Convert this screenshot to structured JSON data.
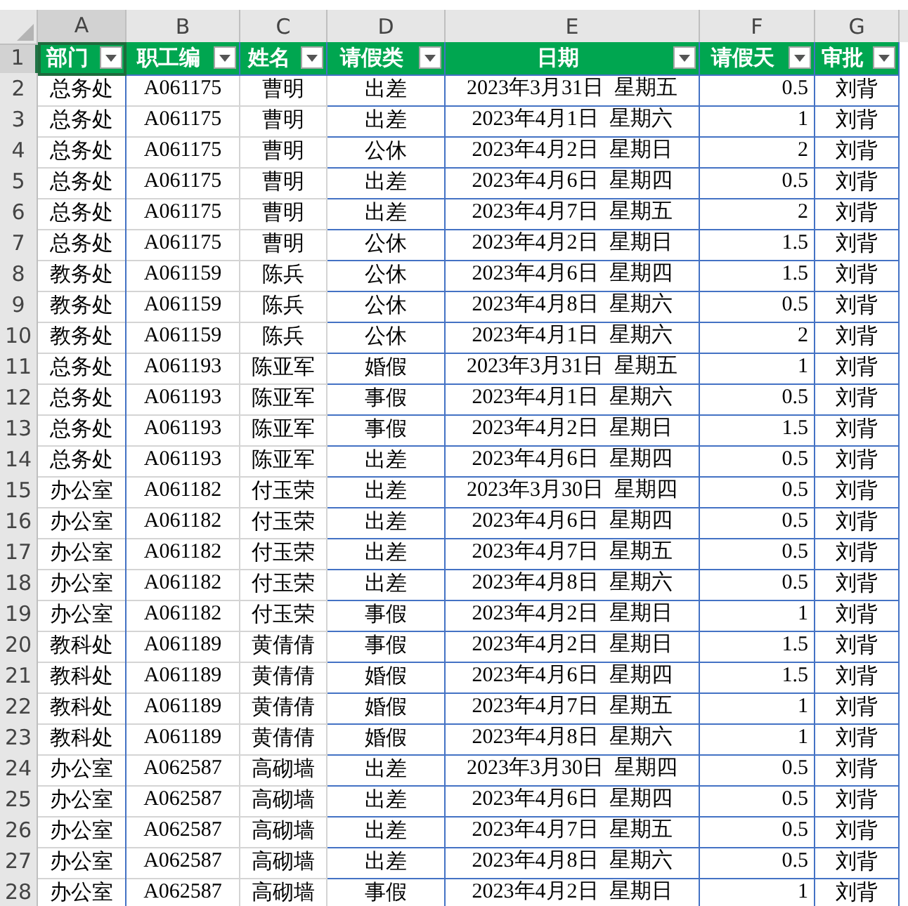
{
  "columns": [
    {
      "letter": "A",
      "selected": true
    },
    {
      "letter": "B",
      "selected": false
    },
    {
      "letter": "C",
      "selected": false
    },
    {
      "letter": "D",
      "selected": false
    },
    {
      "letter": "E",
      "selected": false
    },
    {
      "letter": "F",
      "selected": false
    },
    {
      "letter": "G",
      "selected": false
    }
  ],
  "header_row": {
    "number": "1",
    "selected": true,
    "cells": [
      {
        "text": "部门",
        "selected": true
      },
      {
        "text": "职工编",
        "selected": false
      },
      {
        "text": "姓名",
        "selected": false
      },
      {
        "text": "请假类",
        "selected": false
      },
      {
        "text": "日期",
        "selected": false
      },
      {
        "text": "请假天",
        "selected": false
      },
      {
        "text": "审批",
        "selected": false
      }
    ]
  },
  "rows": [
    {
      "number": "2",
      "selected": false,
      "cells": [
        "总务处",
        "A061175",
        "曹明",
        "出差",
        "2023年3月31日  星期五",
        "0.5",
        "刘背"
      ]
    },
    {
      "number": "3",
      "selected": false,
      "cells": [
        "总务处",
        "A061175",
        "曹明",
        "出差",
        "2023年4月1日  星期六",
        "1",
        "刘背"
      ]
    },
    {
      "number": "4",
      "selected": false,
      "cells": [
        "总务处",
        "A061175",
        "曹明",
        "公休",
        "2023年4月2日  星期日",
        "2",
        "刘背"
      ]
    },
    {
      "number": "5",
      "selected": false,
      "cells": [
        "总务处",
        "A061175",
        "曹明",
        "出差",
        "2023年4月6日  星期四",
        "0.5",
        "刘背"
      ]
    },
    {
      "number": "6",
      "selected": false,
      "cells": [
        "总务处",
        "A061175",
        "曹明",
        "出差",
        "2023年4月7日  星期五",
        "2",
        "刘背"
      ]
    },
    {
      "number": "7",
      "selected": false,
      "cells": [
        "总务处",
        "A061175",
        "曹明",
        "公休",
        "2023年4月2日  星期日",
        "1.5",
        "刘背"
      ]
    },
    {
      "number": "8",
      "selected": false,
      "cells": [
        "教务处",
        "A061159",
        "陈兵",
        "公休",
        "2023年4月6日  星期四",
        "1.5",
        "刘背"
      ]
    },
    {
      "number": "9",
      "selected": false,
      "cells": [
        "教务处",
        "A061159",
        "陈兵",
        "公休",
        "2023年4月8日  星期六",
        "0.5",
        "刘背"
      ]
    },
    {
      "number": "10",
      "selected": false,
      "cells": [
        "教务处",
        "A061159",
        "陈兵",
        "公休",
        "2023年4月1日  星期六",
        "2",
        "刘背"
      ]
    },
    {
      "number": "11",
      "selected": false,
      "cells": [
        "总务处",
        "A061193",
        "陈亚军",
        "婚假",
        "2023年3月31日  星期五",
        "1",
        "刘背"
      ]
    },
    {
      "number": "12",
      "selected": false,
      "cells": [
        "总务处",
        "A061193",
        "陈亚军",
        "事假",
        "2023年4月1日  星期六",
        "0.5",
        "刘背"
      ]
    },
    {
      "number": "13",
      "selected": false,
      "cells": [
        "总务处",
        "A061193",
        "陈亚军",
        "事假",
        "2023年4月2日  星期日",
        "1.5",
        "刘背"
      ]
    },
    {
      "number": "14",
      "selected": false,
      "cells": [
        "总务处",
        "A061193",
        "陈亚军",
        "出差",
        "2023年4月6日  星期四",
        "0.5",
        "刘背"
      ]
    },
    {
      "number": "15",
      "selected": false,
      "cells": [
        "办公室",
        "A061182",
        "付玉荣",
        "出差",
        "2023年3月30日  星期四",
        "0.5",
        "刘背"
      ]
    },
    {
      "number": "16",
      "selected": false,
      "cells": [
        "办公室",
        "A061182",
        "付玉荣",
        "出差",
        "2023年4月6日  星期四",
        "0.5",
        "刘背"
      ]
    },
    {
      "number": "17",
      "selected": false,
      "cells": [
        "办公室",
        "A061182",
        "付玉荣",
        "出差",
        "2023年4月7日  星期五",
        "0.5",
        "刘背"
      ]
    },
    {
      "number": "18",
      "selected": false,
      "cells": [
        "办公室",
        "A061182",
        "付玉荣",
        "出差",
        "2023年4月8日  星期六",
        "0.5",
        "刘背"
      ]
    },
    {
      "number": "19",
      "selected": false,
      "cells": [
        "办公室",
        "A061182",
        "付玉荣",
        "事假",
        "2023年4月2日  星期日",
        "1",
        "刘背"
      ]
    },
    {
      "number": "20",
      "selected": false,
      "cells": [
        "教科处",
        "A061189",
        "黄倩倩",
        "事假",
        "2023年4月2日  星期日",
        "1.5",
        "刘背"
      ]
    },
    {
      "number": "21",
      "selected": false,
      "cells": [
        "教科处",
        "A061189",
        "黄倩倩",
        "婚假",
        "2023年4月6日  星期四",
        "1.5",
        "刘背"
      ]
    },
    {
      "number": "22",
      "selected": false,
      "cells": [
        "教科处",
        "A061189",
        "黄倩倩",
        "婚假",
        "2023年4月7日  星期五",
        "1",
        "刘背"
      ]
    },
    {
      "number": "23",
      "selected": false,
      "cells": [
        "教科处",
        "A061189",
        "黄倩倩",
        "婚假",
        "2023年4月8日  星期六",
        "1",
        "刘背"
      ]
    },
    {
      "number": "24",
      "selected": false,
      "cells": [
        "办公室",
        "A062587",
        "高砌墙",
        "出差",
        "2023年3月30日  星期四",
        "0.5",
        "刘背"
      ]
    },
    {
      "number": "25",
      "selected": false,
      "cells": [
        "办公室",
        "A062587",
        "高砌墙",
        "出差",
        "2023年4月6日  星期四",
        "0.5",
        "刘背"
      ]
    },
    {
      "number": "26",
      "selected": false,
      "cells": [
        "办公室",
        "A062587",
        "高砌墙",
        "出差",
        "2023年4月7日  星期五",
        "0.5",
        "刘背"
      ]
    },
    {
      "number": "27",
      "selected": false,
      "cells": [
        "办公室",
        "A062587",
        "高砌墙",
        "出差",
        "2023年4月8日  星期六",
        "0.5",
        "刘背"
      ]
    },
    {
      "number": "28",
      "selected": false,
      "cells": [
        "办公室",
        "A062587",
        "高砌墙",
        "事假",
        "2023年4月2日  星期日",
        "1",
        "刘背"
      ]
    }
  ]
}
